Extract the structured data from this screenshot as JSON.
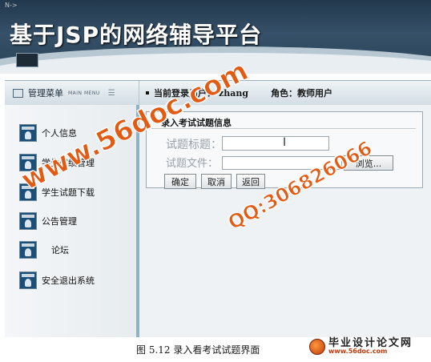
{
  "banner": {
    "title": "基于JSP的网络辅导平台",
    "corner_mark": "N->"
  },
  "header": {
    "menu_title": "管理菜单",
    "menu_subtitle": "MAIN MENU",
    "menu_lines": "☰",
    "current_user_label": "当前登录用户：",
    "current_user_value": "zhang",
    "role_label": "角色：",
    "role_value": "教师用户"
  },
  "sidebar": {
    "items": [
      {
        "label": "个人信息",
        "icon": "user-icon"
      },
      {
        "label": "学生成绩管理",
        "icon": "user-icon"
      },
      {
        "label": "学生试题下载",
        "icon": "user-icon"
      },
      {
        "label": "公告管理",
        "icon": "user-icon"
      },
      {
        "label": "论坛",
        "icon": "user-icon"
      },
      {
        "label": "安全退出系统",
        "icon": "user-icon"
      }
    ]
  },
  "form": {
    "title": "录入考试试题信息",
    "title_label": "试题标题：",
    "file_label": "试题文件：",
    "browse_label": "浏览...",
    "buttons": {
      "confirm": "确定",
      "cancel": "取消",
      "back": "返回"
    }
  },
  "watermarks": {
    "site": "www.56doc.com",
    "qq": "QQ:306826066"
  },
  "caption": {
    "text": "图 5.12 录入看考试试题界面",
    "logo_main": "毕业设计论文网",
    "logo_url": "www.56doc.com"
  },
  "colors": {
    "watermark": "#e35a13",
    "banner": "#2a4357",
    "sidebar_border": "#8fb3c2"
  }
}
